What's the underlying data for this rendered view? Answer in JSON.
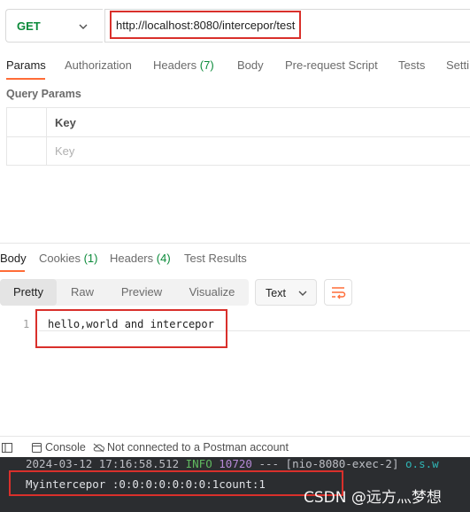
{
  "request": {
    "method": "GET",
    "url": "http://localhost:8080/intercepor/test"
  },
  "request_tabs": {
    "params": "Params",
    "authorization": "Authorization",
    "headers_label": "Headers",
    "headers_count": "(7)",
    "body": "Body",
    "prerequest": "Pre-request Script",
    "tests": "Tests",
    "settings": "Setti"
  },
  "query_params": {
    "title": "Query Params",
    "column_key": "Key",
    "key_placeholder": "Key"
  },
  "response_tabs": {
    "body": "Body",
    "cookies_label": "Cookies",
    "cookies_count": "(1)",
    "headers_label": "Headers",
    "headers_count": "(4)",
    "test_results": "Test Results"
  },
  "view_modes": [
    "Pretty",
    "Raw",
    "Preview",
    "Visualize"
  ],
  "format": "Text",
  "response_body": {
    "line_number": "1",
    "line_text": "hello,world and intercepor"
  },
  "footer": {
    "console": "Console",
    "connection_status": "Not connected to a Postman account"
  },
  "terminal": {
    "timestamp": "2024-03-12 17:16:58.512",
    "level": "INFO",
    "pid": "10720",
    "sep": "---",
    "thread": "[nio-8080-exec-2]",
    "logger": "o.s.w",
    "output": "Myintercepor :0:0:0:0:0:0:0:1count:1"
  },
  "watermark": "CSDN @远方灬梦想",
  "colors": {
    "accent": "#ff6c37",
    "method_get": "#0b8a3a",
    "highlight_box": "#d9302b",
    "count_green": "#0b8a3a",
    "terminal_bg": "#2b2d30"
  }
}
